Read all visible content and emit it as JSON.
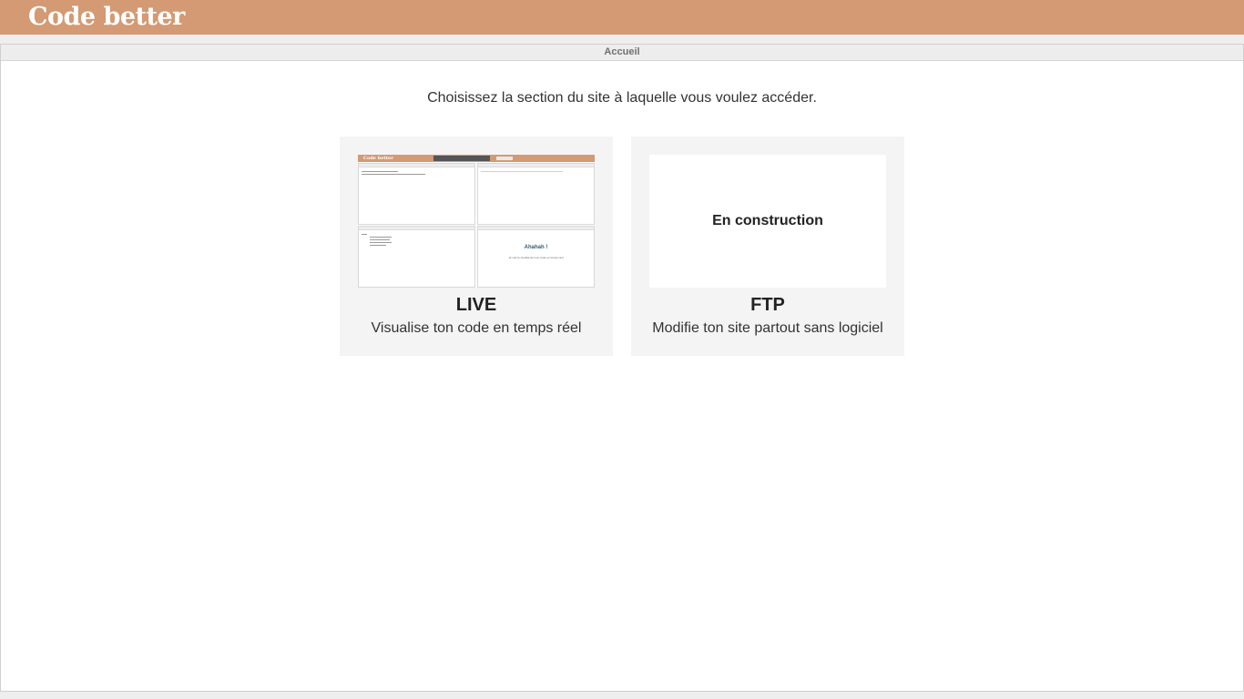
{
  "app": {
    "brand": "Code better"
  },
  "panel": {
    "header": "Accueil"
  },
  "intro": "Choisissez la section du site à laquelle vous voulez accéder.",
  "cards": [
    {
      "title": "LIVE",
      "description": "Visualise ton code en temps réel",
      "preview": {
        "brand": "Code better",
        "result_title": "Ahahah !",
        "result_text": "Je vois le résultat de mon code en temps réel"
      }
    },
    {
      "title": "FTP",
      "description": "Modifie ton site partout sans logiciel",
      "placeholder": "En construction"
    }
  ],
  "colors": {
    "brand_bar": "#d39a74",
    "card_bg": "#f4f4f4",
    "panel_header_bg": "#ededed"
  }
}
